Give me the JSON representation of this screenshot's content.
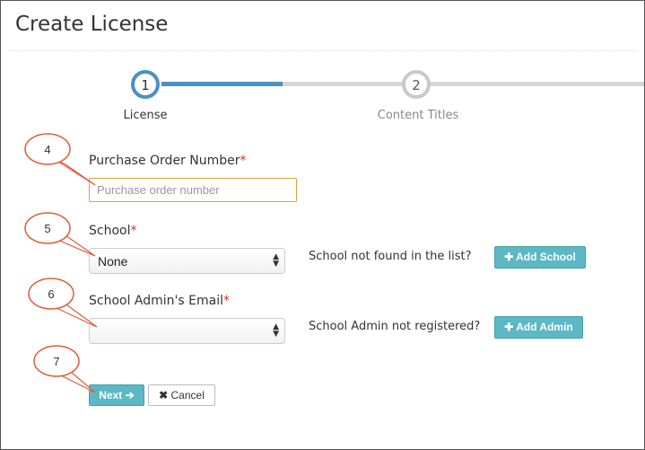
{
  "page": {
    "title": "Create License"
  },
  "steps": [
    {
      "number": "1",
      "label": "License"
    },
    {
      "number": "2",
      "label": "Content Titles"
    }
  ],
  "form": {
    "po_number": {
      "label": "Purchase Order Number",
      "required_mark": "*",
      "placeholder": "Purchase order number",
      "value": ""
    },
    "school": {
      "label": "School",
      "required_mark": "*",
      "selected": "None",
      "hint": "School not found in the list?",
      "button_label": "Add School"
    },
    "admin_email": {
      "label": "School Admin's Email",
      "required_mark": "*",
      "selected": "",
      "hint": "School Admin not registered?",
      "button_label": "Add Admin"
    }
  },
  "actions": {
    "next_label": "Next",
    "cancel_label": "Cancel"
  },
  "callouts": [
    "4",
    "5",
    "6",
    "7"
  ],
  "icons": {
    "plus": "plus-icon",
    "arrow": "arrow-right-icon",
    "close": "close-icon",
    "chevrons": "chevron-updown-icon"
  },
  "colors": {
    "accent": "#4a90c2",
    "button": "#5bb8c4",
    "required": "#c0392b",
    "callout": "#e05a3a"
  }
}
